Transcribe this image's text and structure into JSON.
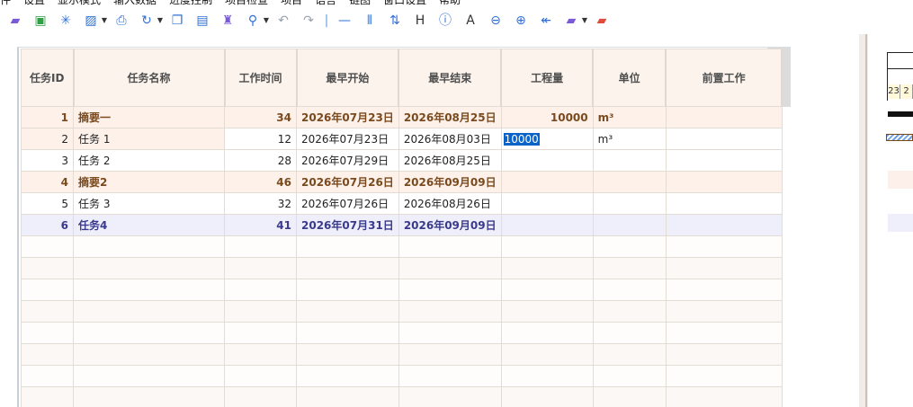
{
  "menu": {
    "items": [
      "件",
      "设置",
      "显示模式",
      "输入数据",
      "进度控制",
      "项目检查",
      "项目",
      "语言",
      "链图",
      "窗口设置",
      "帮助"
    ]
  },
  "toolbar": {
    "icons": [
      "open-folder-icon",
      "save-icon",
      "star-icon",
      "image-export-icon",
      "print-icon",
      "refresh-icon",
      "copy-icon",
      "paste-icon",
      "format-painter-icon",
      "zoom-icon",
      "undo-icon",
      "redo-icon",
      "separator",
      "line-icon",
      "columns-icon",
      "sort-icon",
      "h-icon",
      "info-icon",
      "font-icon",
      "zoom-out-icon",
      "zoom-in-icon",
      "back-icon",
      "folder-icon",
      "red-folder-icon"
    ]
  },
  "grid": {
    "columns": [
      "任务ID",
      "任务名称",
      "工作时间",
      "最早开始",
      "最早结束",
      "工程量",
      "单位",
      "前置工作"
    ],
    "rows": [
      {
        "id": "1",
        "name": "摘要一",
        "duration": "34",
        "start": "2026年07月23日",
        "end": "2026年08月25日",
        "quantity": "10000",
        "unit": "m³",
        "pred": ""
      },
      {
        "id": "2",
        "name": "任务 1",
        "duration": "12",
        "start": "2026年07月23日",
        "end": "2026年08月03日",
        "quantity": "10000",
        "unit": "m³",
        "pred": ""
      },
      {
        "id": "3",
        "name": "任务 2",
        "duration": "28",
        "start": "2026年07月29日",
        "end": "2026年08月25日",
        "quantity": "",
        "unit": "",
        "pred": ""
      },
      {
        "id": "4",
        "name": "摘要2",
        "duration": "46",
        "start": "2026年07月26日",
        "end": "2026年09月09日",
        "quantity": "",
        "unit": "",
        "pred": ""
      },
      {
        "id": "5",
        "name": "任务 3",
        "duration": "32",
        "start": "2026年07月26日",
        "end": "2026年08月26日",
        "quantity": "",
        "unit": "",
        "pred": ""
      },
      {
        "id": "6",
        "name": "任务4",
        "duration": "41",
        "start": "2026年07月31日",
        "end": "2026年09月09日",
        "quantity": "",
        "unit": "",
        "pred": ""
      }
    ]
  },
  "gantt": {
    "days": [
      "23",
      "2"
    ]
  },
  "colors": {
    "accent": "#2f6fd6",
    "summary_text": "#7a4a1e",
    "selected_text": "#3a3a8c",
    "edit_highlight": "#0a63c9"
  }
}
